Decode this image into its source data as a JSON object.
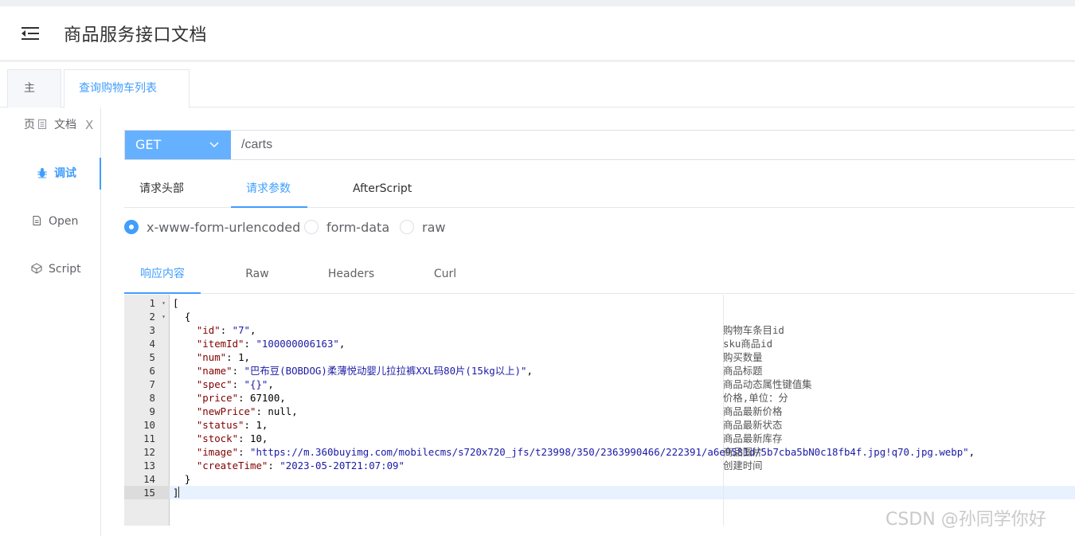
{
  "header": {
    "title": "商品服务接口文档"
  },
  "tabs": {
    "home": "主页",
    "active": "查询购物车列表",
    "close": "X"
  },
  "sidebar": {
    "items": [
      {
        "label": "文档",
        "icon": "document-icon"
      },
      {
        "label": "调试",
        "icon": "bug-icon",
        "active": true
      },
      {
        "label": "Open",
        "icon": "open-file-icon"
      },
      {
        "label": "Script",
        "icon": "script-icon"
      }
    ]
  },
  "request": {
    "method": "GET",
    "url": "/carts",
    "tabs": [
      "请求头部",
      "请求参数",
      "AfterScript"
    ],
    "active_tab": "请求参数",
    "body_types": [
      "x-www-form-urlencoded",
      "form-data",
      "raw"
    ],
    "selected_body_type": "x-www-form-urlencoded"
  },
  "response": {
    "tabs": [
      "响应内容",
      "Raw",
      "Headers",
      "Curl"
    ],
    "active_tab": "响应内容",
    "line_numbers": [
      "1",
      "2",
      "3",
      "4",
      "5",
      "6",
      "7",
      "8",
      "9",
      "10",
      "11",
      "12",
      "13",
      "14",
      "15"
    ],
    "current_line": 15,
    "fields": [
      {
        "key": "id",
        "value": "\"7\"",
        "type": "string",
        "comment": "购物车条目id"
      },
      {
        "key": "itemId",
        "value": "\"100000006163\"",
        "type": "string",
        "comment": "sku商品id"
      },
      {
        "key": "num",
        "value": "1",
        "type": "number",
        "comment": "购买数量"
      },
      {
        "key": "name",
        "value": "\"巴布豆(BOBDOG)柔薄悦动婴儿拉拉裤XXL码80片(15kg以上)\"",
        "type": "string",
        "comment": "商品标题"
      },
      {
        "key": "spec",
        "value": "\"{}\"",
        "type": "string",
        "comment": "商品动态属性键值集"
      },
      {
        "key": "price",
        "value": "67100",
        "type": "number",
        "comment": "价格,单位：分"
      },
      {
        "key": "newPrice",
        "value": "null",
        "type": "null",
        "comment": "商品最新价格"
      },
      {
        "key": "status",
        "value": "1",
        "type": "number",
        "comment": "商品最新状态"
      },
      {
        "key": "stock",
        "value": "10",
        "type": "number",
        "comment": "商品最新库存"
      },
      {
        "key": "image",
        "value": "\"https://m.360buyimg.com/mobilecms/s720x720_jfs/t23998/350/2363990466/222391/a6e9581d/5b7cba5bN0c18fb4f.jpg!q70.jpg.webp\"",
        "type": "string",
        "comment": "商品图片"
      },
      {
        "key": "createTime",
        "value": "\"2023-05-20T21:07:09\"",
        "type": "string",
        "comment": "创建时间"
      }
    ]
  },
  "watermark": "CSDN @孙同学你好",
  "colors": {
    "accent": "#409eff",
    "method_bg": "#66b1ff"
  }
}
